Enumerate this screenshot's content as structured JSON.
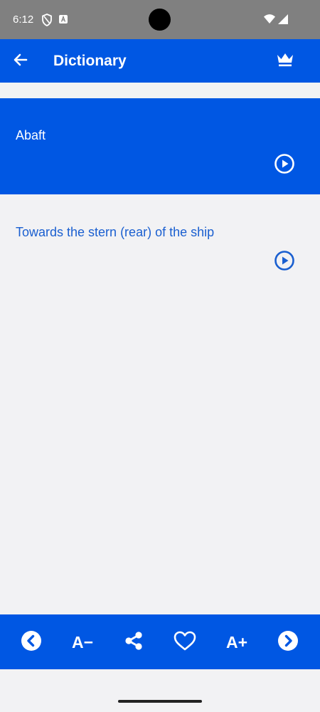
{
  "status_bar": {
    "time": "6:12",
    "icons": [
      "shield-icon",
      "app-a-icon",
      "wifi-icon",
      "signal-icon"
    ]
  },
  "app_bar": {
    "title": "Dictionary",
    "back_icon": "arrow-left-icon",
    "premium_icon": "crown-icon"
  },
  "entry": {
    "word": "Abaft",
    "definition": "Towards the stern (rear) of the ship"
  },
  "toolbar": {
    "previous_icon": "chevron-left-circle-icon",
    "decrease_font_label": "A−",
    "share_icon": "share-icon",
    "favorite_icon": "heart-icon",
    "increase_font_label": "A+",
    "next_icon": "chevron-right-circle-icon"
  },
  "colors": {
    "primary": "#0057e3",
    "definition_text": "#1a5fd0",
    "background": "#f2f2f4",
    "status_bar": "#808080"
  }
}
